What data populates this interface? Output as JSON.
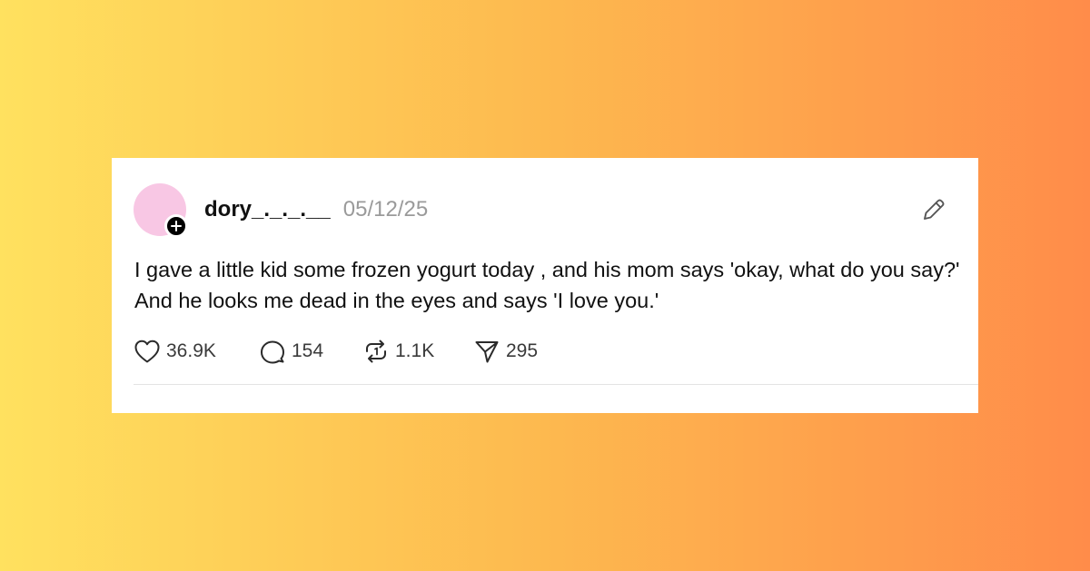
{
  "theme": {
    "gradient_left": "#ffe15f",
    "gradient_mid": "#fdb94f",
    "gradient_right": "#ff8c4a",
    "card_bg": "#ffffff",
    "avatar_color": "#f8c7e4"
  },
  "post": {
    "username": "dory_._._.__",
    "date": "05/12/25",
    "text": "I gave a little kid some frozen yogurt today , and his mom says 'okay, what do you say?' And he looks me dead in the eyes and says 'I love you.'",
    "icons": {
      "avatar_badge": "plus-icon",
      "top_right": "pencil-icon"
    },
    "actions": {
      "likes": {
        "icon": "heart-icon",
        "count": "36.9K"
      },
      "replies": {
        "icon": "speech-bubble-icon",
        "count": "154"
      },
      "reposts": {
        "icon": "repost-icon",
        "count": "1.1K"
      },
      "shares": {
        "icon": "paper-plane-icon",
        "count": "295"
      }
    }
  }
}
